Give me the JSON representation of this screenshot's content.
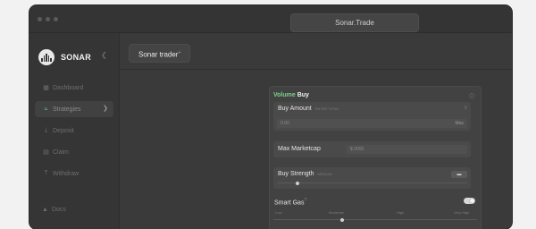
{
  "window": {
    "url": "Sonar.Trade"
  },
  "brand": {
    "name": "SONAR",
    "collapse_icon": "chevron-left"
  },
  "sidebar": {
    "items": [
      {
        "label": "Dashboard",
        "icon": "grid-icon"
      },
      {
        "label": "Strategies",
        "icon": "strategies-icon",
        "active": true
      },
      {
        "label": "Deposit",
        "icon": "deposit-icon"
      },
      {
        "label": "Claim",
        "icon": "claim-icon"
      },
      {
        "label": "Withdraw",
        "icon": "withdraw-icon"
      }
    ],
    "docs": {
      "label": "Docs",
      "icon": "graduation-cap-icon"
    }
  },
  "tab": {
    "label": "Sonar trader",
    "sup": "+"
  },
  "panel": {
    "title_accent": "Volume",
    "title_main": "Buy",
    "buy_amount": {
      "label": "Buy Amount",
      "hint": "ENTER TOTAL",
      "placeholder": "0.00",
      "suffix": "Max"
    },
    "max_marketcap": {
      "label": "Max Marketcap",
      "placeholder": "$ 0000"
    },
    "buy_strength": {
      "label": "Buy Strength",
      "hint": "MEDIUM",
      "button_icon": "sliders-icon",
      "level": 0.1
    },
    "smart_gas": {
      "label": "Smart Gas",
      "sup": "?",
      "enabled": true,
      "levels": [
        "Low",
        "Moderate",
        "High",
        "Very High"
      ],
      "level": 0.33
    }
  },
  "colors": {
    "accent": "#7ad08a",
    "window_bg": "#3a3a3a",
    "panel_bg": "#424242"
  }
}
